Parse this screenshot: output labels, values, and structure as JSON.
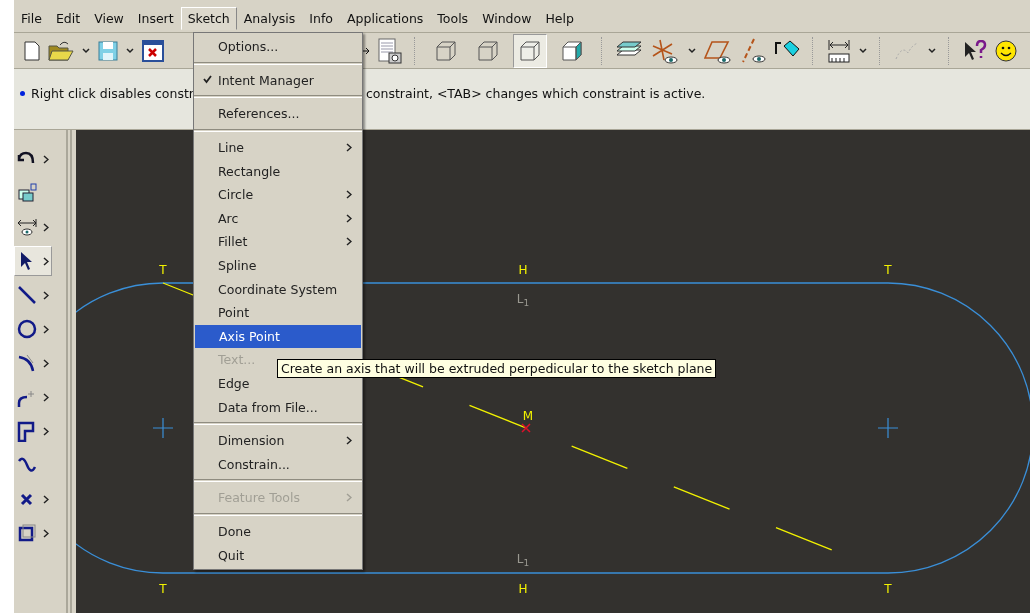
{
  "menubar": [
    {
      "label": "File",
      "selected": false
    },
    {
      "label": "Edit",
      "selected": false
    },
    {
      "label": "View",
      "selected": false
    },
    {
      "label": "Insert",
      "selected": false
    },
    {
      "label": "Sketch",
      "selected": true
    },
    {
      "label": "Analysis",
      "selected": false
    },
    {
      "label": "Info",
      "selected": false
    },
    {
      "label": "Applications",
      "selected": false
    },
    {
      "label": "Tools",
      "selected": false
    },
    {
      "label": "Window",
      "selected": false
    },
    {
      "label": "Help",
      "selected": false
    }
  ],
  "display_style_buttons": [
    {
      "selected": false
    },
    {
      "selected": false
    },
    {
      "selected": true
    },
    {
      "selected": false
    }
  ],
  "status_message": {
    "text_before": "Right click disables constr",
    "text_after": "constraint, <TAB> changes which constraint is active."
  },
  "sketcher_tools": [
    {
      "selected": false
    },
    {
      "selected": false
    },
    {
      "selected": false
    },
    {
      "selected": true
    },
    {
      "selected": false
    },
    {
      "selected": false
    },
    {
      "selected": false
    },
    {
      "selected": false
    },
    {
      "selected": false
    },
    {
      "selected": false
    },
    {
      "selected": false
    },
    {
      "selected": false
    }
  ],
  "sketch_menu": [
    {
      "kind": "item",
      "label": "Options...",
      "checked": false,
      "submenu": false,
      "disabled": false,
      "selected": false
    },
    {
      "kind": "separator"
    },
    {
      "kind": "item",
      "label": "Intent Manager",
      "checked": true,
      "submenu": false,
      "disabled": false,
      "selected": false
    },
    {
      "kind": "separator"
    },
    {
      "kind": "item",
      "label": "References...",
      "checked": false,
      "submenu": false,
      "disabled": false,
      "selected": false
    },
    {
      "kind": "separator"
    },
    {
      "kind": "item",
      "label": "Line",
      "checked": false,
      "submenu": true,
      "disabled": false,
      "selected": false
    },
    {
      "kind": "item",
      "label": "Rectangle",
      "checked": false,
      "submenu": false,
      "disabled": false,
      "selected": false
    },
    {
      "kind": "item",
      "label": "Circle",
      "checked": false,
      "submenu": true,
      "disabled": false,
      "selected": false
    },
    {
      "kind": "item",
      "label": "Arc",
      "checked": false,
      "submenu": true,
      "disabled": false,
      "selected": false
    },
    {
      "kind": "item",
      "label": "Fillet",
      "checked": false,
      "submenu": true,
      "disabled": false,
      "selected": false
    },
    {
      "kind": "item",
      "label": "Spline",
      "checked": false,
      "submenu": false,
      "disabled": false,
      "selected": false
    },
    {
      "kind": "item",
      "label": "Coordinate System",
      "checked": false,
      "submenu": false,
      "disabled": false,
      "selected": false
    },
    {
      "kind": "item",
      "label": "Point",
      "checked": false,
      "submenu": false,
      "disabled": false,
      "selected": false
    },
    {
      "kind": "item",
      "label": "Axis Point",
      "checked": false,
      "submenu": false,
      "disabled": false,
      "selected": true
    },
    {
      "kind": "item",
      "label": "Text...",
      "checked": false,
      "submenu": false,
      "disabled": true,
      "selected": false
    },
    {
      "kind": "item",
      "label": "Edge",
      "checked": false,
      "submenu": false,
      "disabled": false,
      "selected": false
    },
    {
      "kind": "item",
      "label": "Data from File...",
      "checked": false,
      "submenu": false,
      "disabled": false,
      "selected": false
    },
    {
      "kind": "separator"
    },
    {
      "kind": "item",
      "label": "Dimension",
      "checked": false,
      "submenu": true,
      "disabled": false,
      "selected": false
    },
    {
      "kind": "item",
      "label": "Constrain...",
      "checked": false,
      "submenu": false,
      "disabled": false,
      "selected": false
    },
    {
      "kind": "separator"
    },
    {
      "kind": "item",
      "label": "Feature Tools",
      "checked": false,
      "submenu": true,
      "disabled": true,
      "selected": false
    },
    {
      "kind": "separator"
    },
    {
      "kind": "item",
      "label": "Done",
      "checked": false,
      "submenu": false,
      "disabled": false,
      "selected": false
    },
    {
      "kind": "item",
      "label": "Quit",
      "checked": false,
      "submenu": false,
      "disabled": false,
      "selected": false
    }
  ],
  "tooltip": {
    "text": "Create an axis that will be extruded perpedicular to the sketch plane"
  },
  "sketch": {
    "top_constraints": [
      "T",
      "H",
      "T"
    ],
    "line_labels": [
      "L$_{1}$",
      "L$_{1}$"
    ],
    "midpoint_label": "M",
    "bottom_constraints": [
      "T",
      "H",
      "T"
    ]
  }
}
